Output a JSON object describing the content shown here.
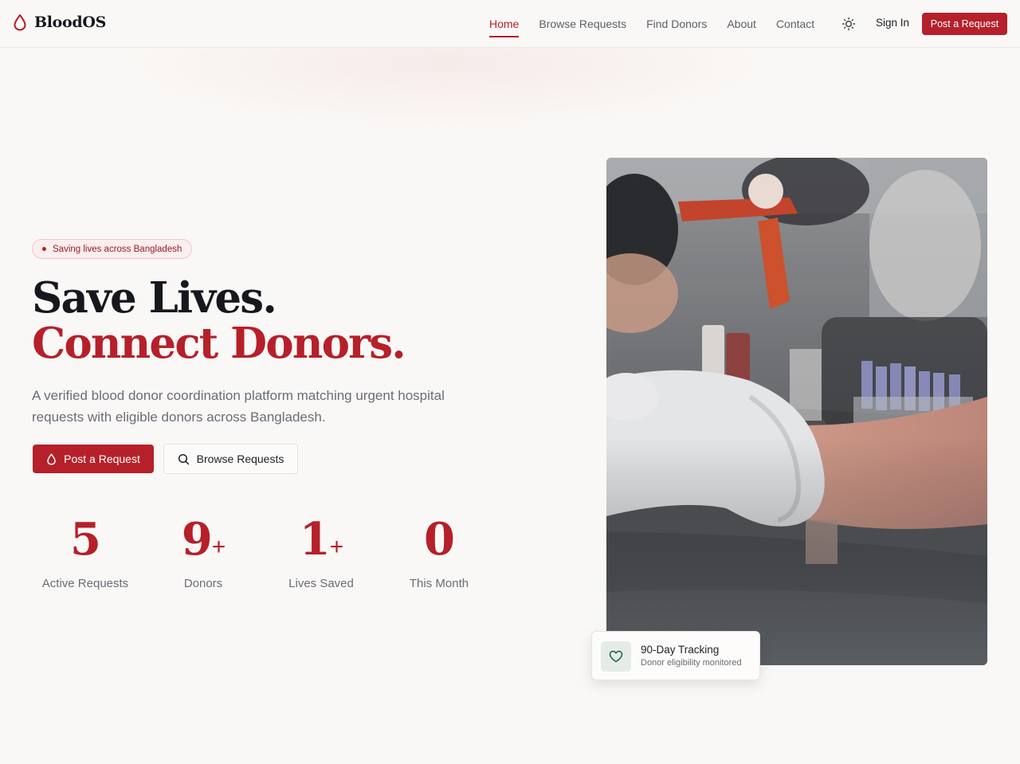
{
  "brand": {
    "name": "BloodOS",
    "icon": "blood-drop-icon",
    "color": "#b5202a"
  },
  "nav": {
    "items": [
      {
        "label": "Home",
        "active": true
      },
      {
        "label": "Browse Requests",
        "active": false
      },
      {
        "label": "Find Donors",
        "active": false
      },
      {
        "label": "About",
        "active": false
      },
      {
        "label": "Contact",
        "active": false
      }
    ],
    "theme_icon": "sun-icon",
    "sign_in": "Sign In",
    "cta": "Post a Request"
  },
  "hero": {
    "badge": "Saving lives across Bangladesh",
    "headline_line1": "Save Lives.",
    "headline_line2": "Connect Donors.",
    "lead": "A verified blood donor coordination platform matching urgent hospital requests with eligible donors across Bangladesh.",
    "primary_button": {
      "label": "Post a Request",
      "icon": "blood-drop-icon"
    },
    "secondary_button": {
      "label": "Browse Requests",
      "icon": "search-icon"
    }
  },
  "stats": [
    {
      "value": "5",
      "suffix": "",
      "label": "Active Requests"
    },
    {
      "value": "9",
      "suffix": "+",
      "label": "Donors"
    },
    {
      "value": "1",
      "suffix": "+",
      "label": "Lives Saved"
    },
    {
      "value": "0",
      "suffix": "",
      "label": "This Month"
    }
  ],
  "tracking_card": {
    "icon": "heart-icon",
    "title": "90-Day Tracking",
    "subtitle": "Donor eligibility monitored"
  },
  "colors": {
    "accent": "#b5202a",
    "background": "#faf8f6",
    "text": "#16181d",
    "muted": "#6a6d74"
  }
}
